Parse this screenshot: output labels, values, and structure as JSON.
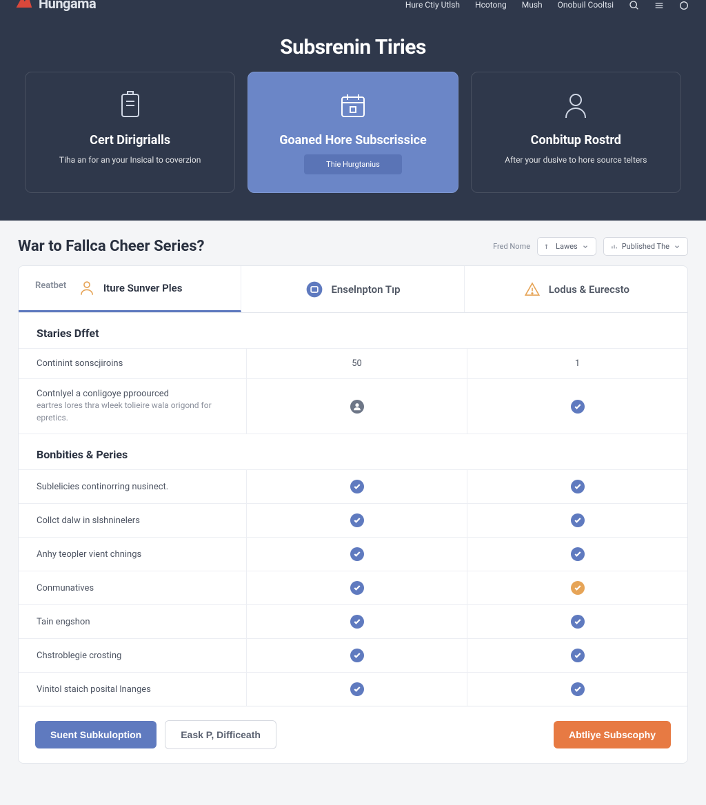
{
  "topbar": {
    "brand": "Hungama",
    "links": [
      "Hure Ctiy Utlsh",
      "Hcotong",
      "Mush",
      "Onobuil Cooltsi"
    ]
  },
  "hero": {
    "title": "Subsrenin Tiries",
    "cards": [
      {
        "title": "Cert Dirigrialls",
        "desc": "Tiha an for an your Insical to coverzion"
      },
      {
        "title": "Goaned Hore Subscrissice",
        "cta": "Thie Hurgtanius"
      },
      {
        "title": "Conbitup Rostrd",
        "desc": "After your dusive to hore source telters"
      }
    ]
  },
  "panel": {
    "heading": "War to Fallca Cheer Series?",
    "filter_label": "Fred Nome",
    "dropdown1": "Lawes",
    "dropdown2": "Published The",
    "tab_sublabel": "Reatbet",
    "tabs": [
      {
        "label": "Iture Sunver Ples"
      },
      {
        "label": "Enselnpton Tıp"
      },
      {
        "label": "Lodus & Eurecsto"
      }
    ],
    "section1": {
      "title": "Staries Dffet",
      "rows": [
        {
          "label": "Continint sonscjiroins",
          "v1": "50",
          "v2": "1"
        },
        {
          "label": "Contnlyel a conligoye pproourced",
          "desc": "eartres lores thrа wleek tolieire wala origond for epretics."
        }
      ]
    },
    "section2": {
      "title": "Bonbities & Peries",
      "rows": [
        {
          "label": "Sublelicies continorring nusinect."
        },
        {
          "label": "Collct dalw in slshninelers"
        },
        {
          "label": "Anhy teopler vient chnings"
        },
        {
          "label": "Conmunatives"
        },
        {
          "label": "Tain engshon"
        },
        {
          "label": "Chstroblegie crosting"
        },
        {
          "label": "Vinitol staich posital lnanges"
        }
      ]
    },
    "footer": {
      "primary": "Suent Subkuloption",
      "secondary": "Eask P, Difficeath",
      "accent": "Abtliye Subscophy"
    }
  }
}
